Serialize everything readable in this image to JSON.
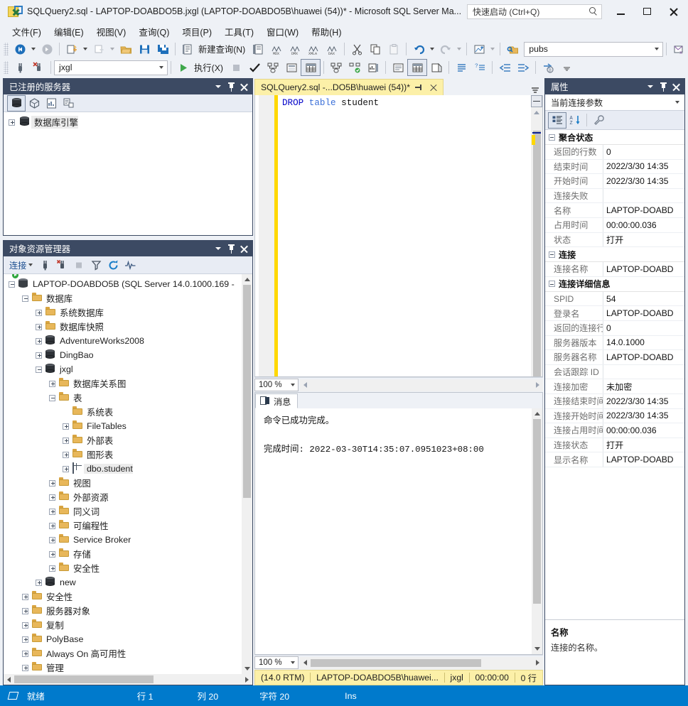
{
  "window": {
    "title": "SQLQuery2.sql - LAPTOP-DOABDO5B.jxgl (LAPTOP-DOABDO5B\\huawei (54))* - Microsoft SQL Server Ma...",
    "quick_launch_placeholder": "快速启动 (Ctrl+Q)",
    "minimize_label": "最小化",
    "maximize_label": "最大化",
    "close_label": "关闭"
  },
  "menu": {
    "items": [
      {
        "label": "文件(F)"
      },
      {
        "label": "编辑(E)"
      },
      {
        "label": "视图(V)"
      },
      {
        "label": "查询(Q)"
      },
      {
        "label": "项目(P)"
      },
      {
        "label": "工具(T)"
      },
      {
        "label": "窗口(W)"
      },
      {
        "label": "帮助(H)"
      }
    ]
  },
  "toolbar": {
    "new_query_label": "新建查询(N)",
    "execute_label": "执行(X)",
    "database_combo_value": "pubs",
    "available_databases_value": "jxgl"
  },
  "registered_servers": {
    "title": "已注册的服务器",
    "tree": [
      {
        "label": "数据库引擎",
        "icon": "database-cylinder-icon",
        "expander": "plus",
        "selected": true
      }
    ]
  },
  "object_explorer": {
    "title": "对象资源管理器",
    "connect_label": "连接",
    "tree": [
      {
        "label": "LAPTOP-DOABDO5B (SQL Server 14.0.1000.169 -",
        "icon": "server-icon",
        "expander": "minus",
        "indent": 0
      },
      {
        "label": "数据库",
        "icon": "folder-icon",
        "expander": "minus",
        "indent": 1
      },
      {
        "label": "系统数据库",
        "icon": "folder-icon",
        "expander": "plus",
        "indent": 2
      },
      {
        "label": "数据库快照",
        "icon": "folder-icon",
        "expander": "plus",
        "indent": 2
      },
      {
        "label": "AdventureWorks2008",
        "icon": "database-cylinder-icon",
        "expander": "plus",
        "indent": 2
      },
      {
        "label": "DingBao",
        "icon": "database-cylinder-icon",
        "expander": "plus",
        "indent": 2
      },
      {
        "label": "jxgl",
        "icon": "database-cylinder-icon",
        "expander": "minus",
        "indent": 2
      },
      {
        "label": "数据库关系图",
        "icon": "folder-icon",
        "expander": "plus",
        "indent": 3
      },
      {
        "label": "表",
        "icon": "folder-icon",
        "expander": "minus",
        "indent": 3
      },
      {
        "label": "系统表",
        "icon": "folder-icon",
        "expander": "none",
        "indent": 4
      },
      {
        "label": "FileTables",
        "icon": "folder-icon",
        "expander": "plus",
        "indent": 4
      },
      {
        "label": "外部表",
        "icon": "folder-icon",
        "expander": "plus",
        "indent": 4
      },
      {
        "label": "图形表",
        "icon": "folder-icon",
        "expander": "plus",
        "indent": 4
      },
      {
        "label": "dbo.student",
        "icon": "table-icon",
        "expander": "plus",
        "indent": 4,
        "selected": true
      },
      {
        "label": "视图",
        "icon": "folder-icon",
        "expander": "plus",
        "indent": 3
      },
      {
        "label": "外部资源",
        "icon": "folder-icon",
        "expander": "plus",
        "indent": 3
      },
      {
        "label": "同义词",
        "icon": "folder-icon",
        "expander": "plus",
        "indent": 3
      },
      {
        "label": "可编程性",
        "icon": "folder-icon",
        "expander": "plus",
        "indent": 3
      },
      {
        "label": "Service Broker",
        "icon": "folder-icon",
        "expander": "plus",
        "indent": 3
      },
      {
        "label": "存储",
        "icon": "folder-icon",
        "expander": "plus",
        "indent": 3
      },
      {
        "label": "安全性",
        "icon": "folder-icon",
        "expander": "plus",
        "indent": 3
      },
      {
        "label": "new",
        "icon": "database-cylinder-icon",
        "expander": "plus",
        "indent": 2
      },
      {
        "label": "安全性",
        "icon": "folder-icon",
        "expander": "plus",
        "indent": 1
      },
      {
        "label": "服务器对象",
        "icon": "folder-icon",
        "expander": "plus",
        "indent": 1
      },
      {
        "label": "复制",
        "icon": "folder-icon",
        "expander": "plus",
        "indent": 1
      },
      {
        "label": "PolyBase",
        "icon": "folder-icon",
        "expander": "plus",
        "indent": 1
      },
      {
        "label": "Always On 高可用性",
        "icon": "folder-icon",
        "expander": "plus",
        "indent": 1
      },
      {
        "label": "管理",
        "icon": "folder-icon",
        "expander": "plus",
        "indent": 1
      }
    ]
  },
  "editor": {
    "tab_label": "SQLQuery2.sql -...DO5B\\huawei (54))*",
    "code": {
      "kw1": "DROP",
      "kw2": "table",
      "ident": "student"
    },
    "zoom": "100 %"
  },
  "results": {
    "tab_label": "消息",
    "lines": [
      "命令已成功完成。",
      "",
      "完成时间: 2022-03-30T14:35:07.0951023+08:00"
    ],
    "zoom": "100 %"
  },
  "query_status": {
    "cells": [
      "(14.0 RTM)",
      "LAPTOP-DOABDO5B\\huawei...",
      "jxgl",
      "00:00:00",
      "0 行"
    ]
  },
  "properties": {
    "title": "属性",
    "combo_value": "当前连接参数",
    "groups": [
      {
        "name": "聚合状态",
        "rows": [
          {
            "name": "返回的行数",
            "value": "0"
          },
          {
            "name": "结束时间",
            "value": "2022/3/30 14:35"
          },
          {
            "name": "开始时间",
            "value": "2022/3/30 14:35"
          },
          {
            "name": "连接失败",
            "value": ""
          },
          {
            "name": "名称",
            "value": "LAPTOP-DOABD"
          },
          {
            "name": "占用时间",
            "value": "00:00:00.036"
          },
          {
            "name": "状态",
            "value": "打开"
          }
        ]
      },
      {
        "name": "连接",
        "rows": [
          {
            "name": "连接名称",
            "value": "LAPTOP-DOABD"
          }
        ]
      },
      {
        "name": "连接详细信息",
        "rows": [
          {
            "name": "SPID",
            "value": "54"
          },
          {
            "name": "登录名",
            "value": "LAPTOP-DOABD"
          },
          {
            "name": "返回的连接行",
            "value": "0"
          },
          {
            "name": "服务器版本",
            "value": "14.0.1000"
          },
          {
            "name": "服务器名称",
            "value": "LAPTOP-DOABD"
          },
          {
            "name": "会话跟踪 ID",
            "value": ""
          },
          {
            "name": "连接加密",
            "value": "未加密"
          },
          {
            "name": "连接结束时间",
            "value": "2022/3/30 14:35"
          },
          {
            "name": "连接开始时间",
            "value": "2022/3/30 14:35"
          },
          {
            "name": "连接占用时间",
            "value": "00:00:00.036"
          },
          {
            "name": "连接状态",
            "value": "打开"
          },
          {
            "name": "显示名称",
            "value": "LAPTOP-DOABD"
          }
        ]
      }
    ],
    "description_title": "名称",
    "description_body": "连接的名称。"
  },
  "statusbar": {
    "ready": "就绪",
    "line": "行 1",
    "column": "列 20",
    "chars": "字符 20",
    "insert_mode": "Ins"
  },
  "colors": {
    "accent": "#007acc",
    "panel_title": "#3c4a63",
    "tab_active": "#fcf0a8",
    "chrome": "#eef1f6"
  }
}
